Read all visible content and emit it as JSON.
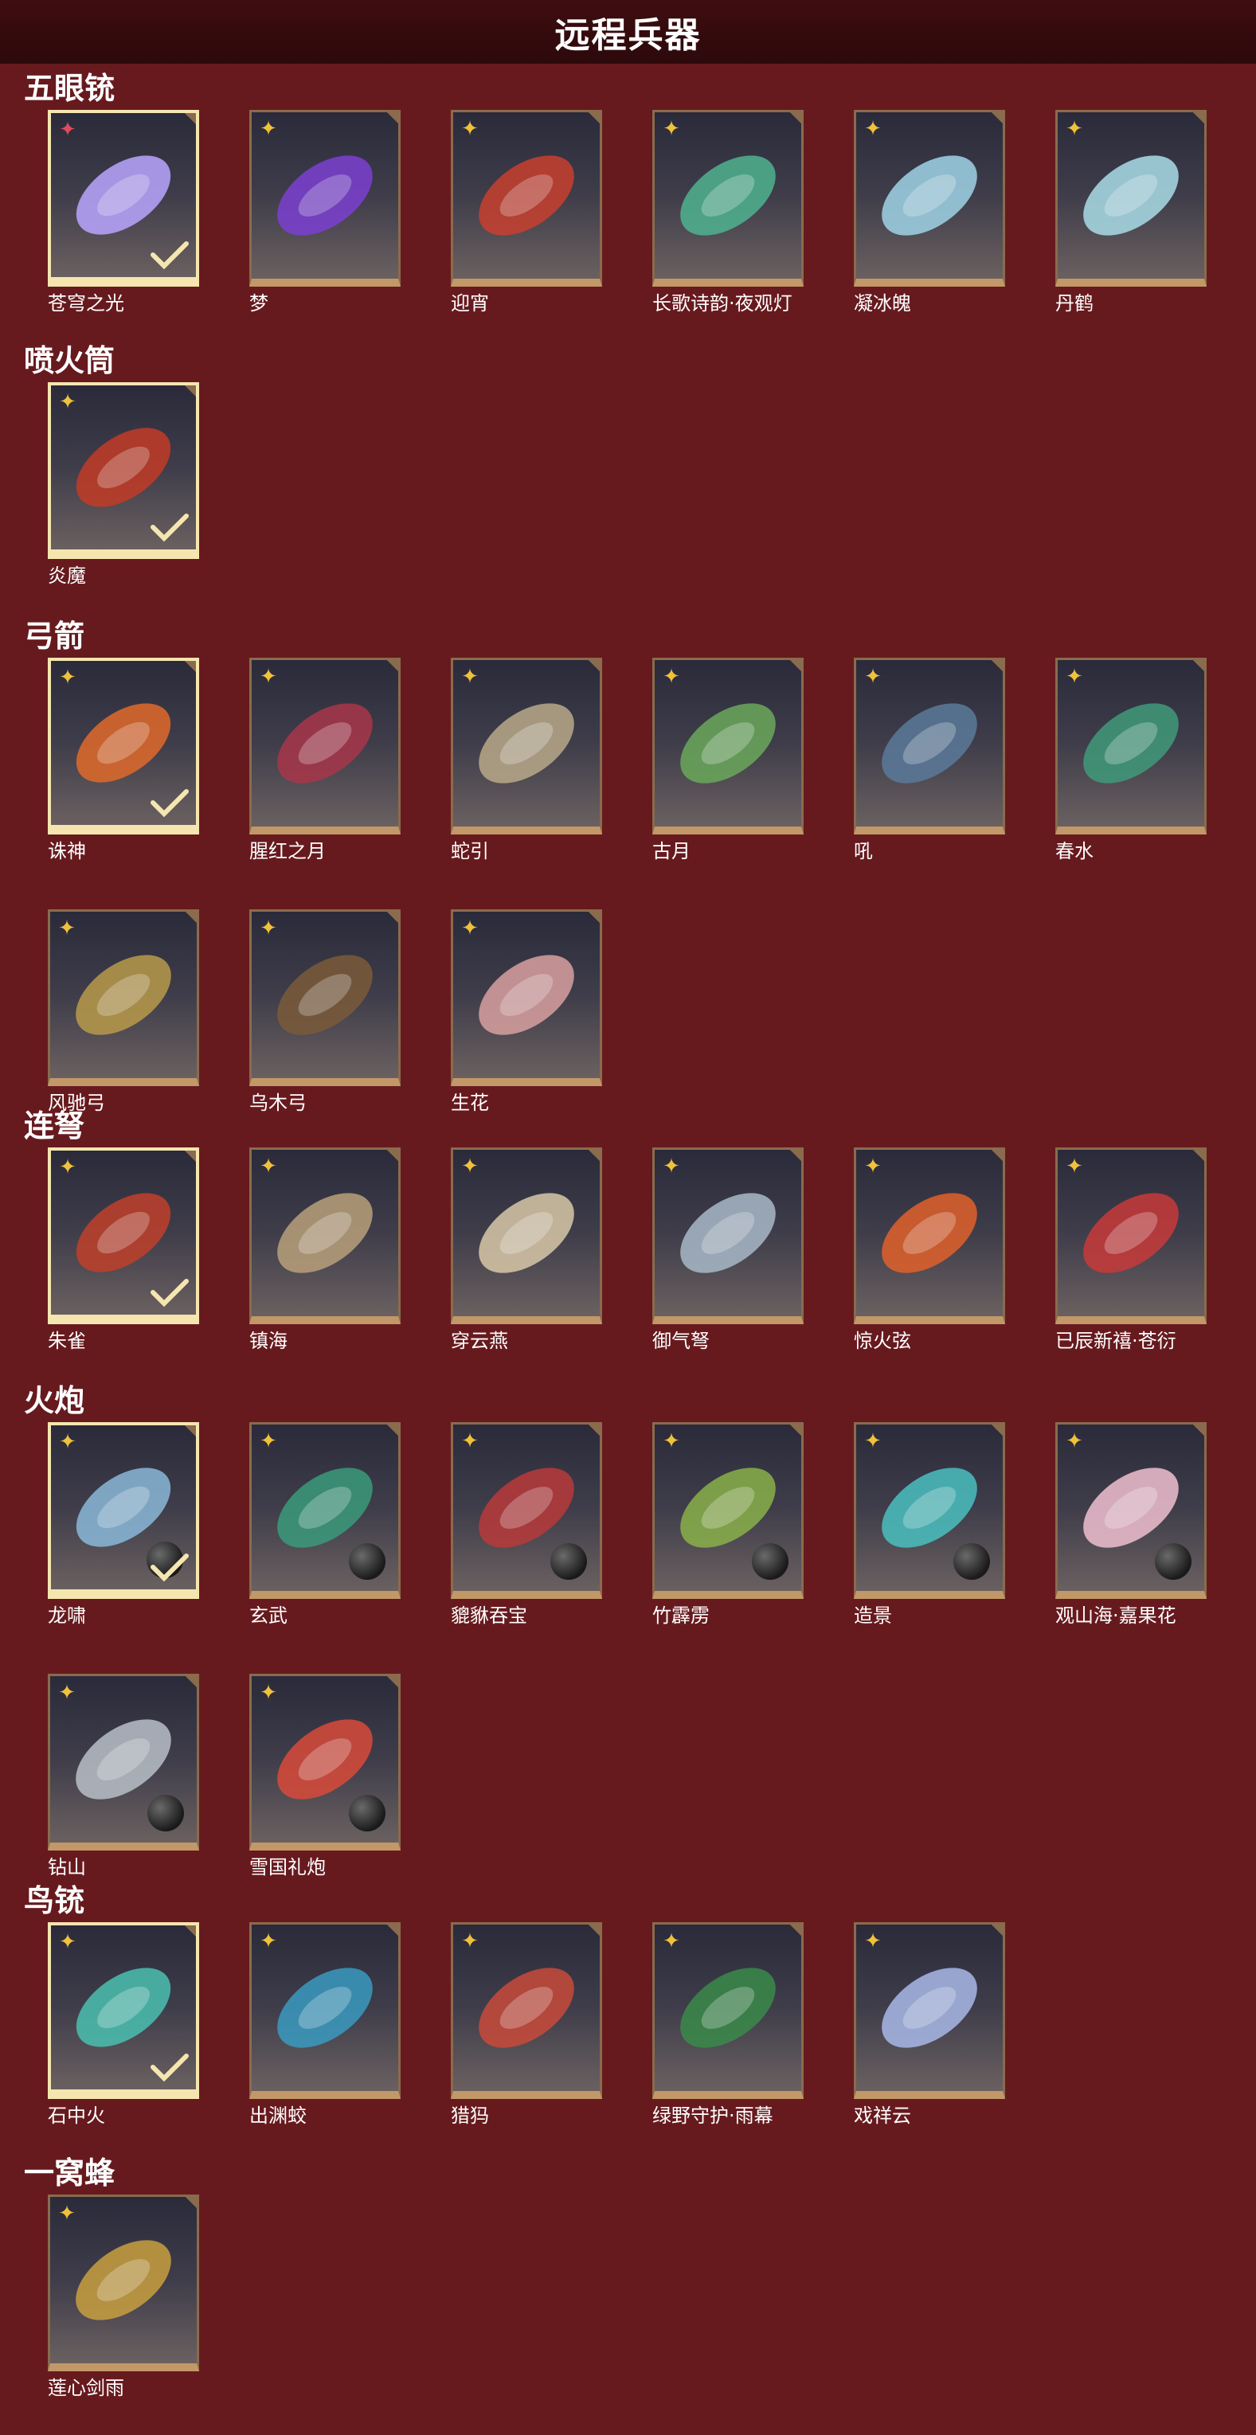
{
  "page": {
    "title": "远程兵器"
  },
  "colors": {
    "background": "#671a1e",
    "header": "#2c090b",
    "accent": "#f0c23a",
    "frame": "#c39868",
    "selected_frame": "#f5e6b0"
  },
  "sections": [
    {
      "title": "五眼铳",
      "items": [
        {
          "name": "苍穹之光",
          "selected": true,
          "badge": "red",
          "art": "#b9a6ff"
        },
        {
          "name": "梦",
          "art": "#7b3fd1"
        },
        {
          "name": "迎宵",
          "art": "#c8402f"
        },
        {
          "name": "长歌诗韵·夜观灯",
          "art": "#4fb38f"
        },
        {
          "name": "凝冰魄",
          "art": "#9fd4e6"
        },
        {
          "name": "丹鹤",
          "art": "#a9dde8"
        }
      ]
    },
    {
      "title": "喷火筒",
      "items": [
        {
          "name": "炎魔",
          "selected": true,
          "art": "#c23b26"
        }
      ]
    },
    {
      "title": "弓箭",
      "items": [
        {
          "name": "诛神",
          "selected": true,
          "art": "#e06a2a"
        },
        {
          "name": "腥红之月",
          "art": "#a8364a"
        },
        {
          "name": "蛇引",
          "art": "#b8a98a"
        },
        {
          "name": "古月",
          "art": "#6aa85a"
        },
        {
          "name": "吼",
          "art": "#5a7a9a"
        },
        {
          "name": "春水",
          "art": "#3f9a7a"
        },
        {
          "name": "风驰弓",
          "art": "#b89a4a"
        },
        {
          "name": "乌木弓",
          "art": "#7a5a3a"
        },
        {
          "name": "生花",
          "art": "#d8a0a0"
        }
      ]
    },
    {
      "title": "连弩",
      "items": [
        {
          "name": "朱雀",
          "selected": true,
          "art": "#c0402a"
        },
        {
          "name": "镇海",
          "art": "#b8a07a"
        },
        {
          "name": "穿云燕",
          "art": "#d8c8a8"
        },
        {
          "name": "御气弩",
          "art": "#a8b8c8"
        },
        {
          "name": "惊火弦",
          "art": "#e0602a"
        },
        {
          "name": "已辰新禧·苍衍",
          "art": "#c83a3a"
        }
      ]
    },
    {
      "title": "火炮",
      "items": [
        {
          "name": "龙啸",
          "selected": true,
          "ball": true,
          "art": "#8ab8d8"
        },
        {
          "name": "玄武",
          "ball": true,
          "art": "#3a9a7a"
        },
        {
          "name": "貔貅吞宝",
          "ball": true,
          "art": "#b83a3a"
        },
        {
          "name": "竹霹雳",
          "ball": true,
          "art": "#8ab04a"
        },
        {
          "name": "造景",
          "ball": true,
          "art": "#4ac0c0"
        },
        {
          "name": "观山海·嘉果花",
          "ball": true,
          "art": "#f0c0d0"
        },
        {
          "name": "钻山",
          "ball": true,
          "art": "#b8c0c8"
        },
        {
          "name": "雪国礼炮",
          "ball": true,
          "art": "#d84a3a"
        }
      ]
    },
    {
      "title": "鸟铳",
      "items": [
        {
          "name": "石中火",
          "selected": true,
          "art": "#4ac0b0"
        },
        {
          "name": "出渊蛟",
          "art": "#3a9ac0"
        },
        {
          "name": "猎犸",
          "art": "#c84a3a"
        },
        {
          "name": "绿野守护·雨幕",
          "art": "#3a8a4a"
        },
        {
          "name": "戏祥云",
          "art": "#a8b8e8"
        }
      ]
    },
    {
      "title": "一窝蜂",
      "items": [
        {
          "name": "莲心剑雨",
          "art": "#c8a040"
        }
      ]
    }
  ]
}
